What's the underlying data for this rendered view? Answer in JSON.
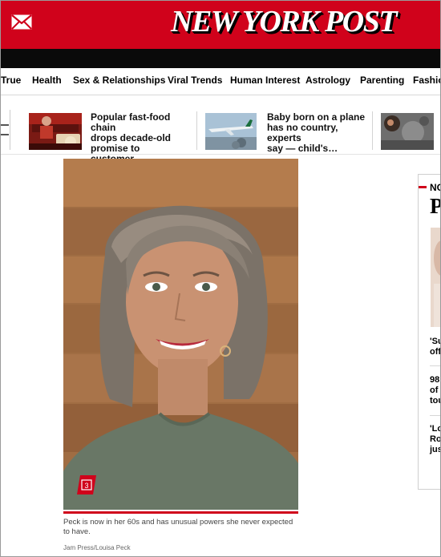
{
  "header": {
    "logo_text": "NEW YORK POST",
    "mail_icon": "envelope-icon",
    "brand_color": "#d0021b"
  },
  "nav": {
    "items": [
      {
        "label": "True"
      },
      {
        "label": "Health"
      },
      {
        "label": "Sex & Relationships"
      },
      {
        "label": "Viral Trends"
      },
      {
        "label": "Human Interest"
      },
      {
        "label": "Astrology"
      },
      {
        "label": "Parenting"
      },
      {
        "label": "Fashio"
      }
    ]
  },
  "trending": {
    "cards": [
      {
        "headline_line1": "Popular fast-food chain",
        "headline_line2": "drops decade-old",
        "headline_line3": "promise to customer…"
      },
      {
        "headline_line1": "Baby born on a plane",
        "headline_line2": "has no country, experts",
        "headline_line3": "say — child's…"
      }
    ]
  },
  "article": {
    "photo_counter": "3",
    "caption": "Peck is now in her 60s and has unusual powers she never expected to have.",
    "credit": "Jam Press/Louisa Peck"
  },
  "rail": {
    "heading": "NO",
    "big_letter": "P",
    "items": [
      {
        "line1": "'Su",
        "line2": "off"
      },
      {
        "line1": "98",
        "line2": "of",
        "line3": "tou"
      },
      {
        "line1": "'Lo",
        "line2": "Ro",
        "line3": "jus"
      }
    ]
  }
}
